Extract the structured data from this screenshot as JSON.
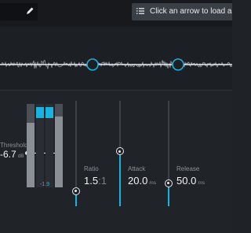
{
  "header": {
    "preset_placeholder": "Click an arrow to load a preset"
  },
  "threshold": {
    "label": "Threshold",
    "value": "-6.7",
    "unit": "dB"
  },
  "meter": {
    "gain_reduction_readout": "-1.9"
  },
  "ratio": {
    "label": "Ratio",
    "value": "1.5",
    "suffix": ":1",
    "level": 0.14
  },
  "attack": {
    "label": "Attack",
    "value": "20.0",
    "unit": "ms",
    "level": 0.52
  },
  "release": {
    "label": "Release",
    "value": "50.0",
    "unit": "ms",
    "level": 0.22
  },
  "colors": {
    "accent": "#19b3e0",
    "background": "#1f2227",
    "text": "#f2f4f6"
  },
  "icons": [
    "pencil-icon",
    "list-icon"
  ]
}
